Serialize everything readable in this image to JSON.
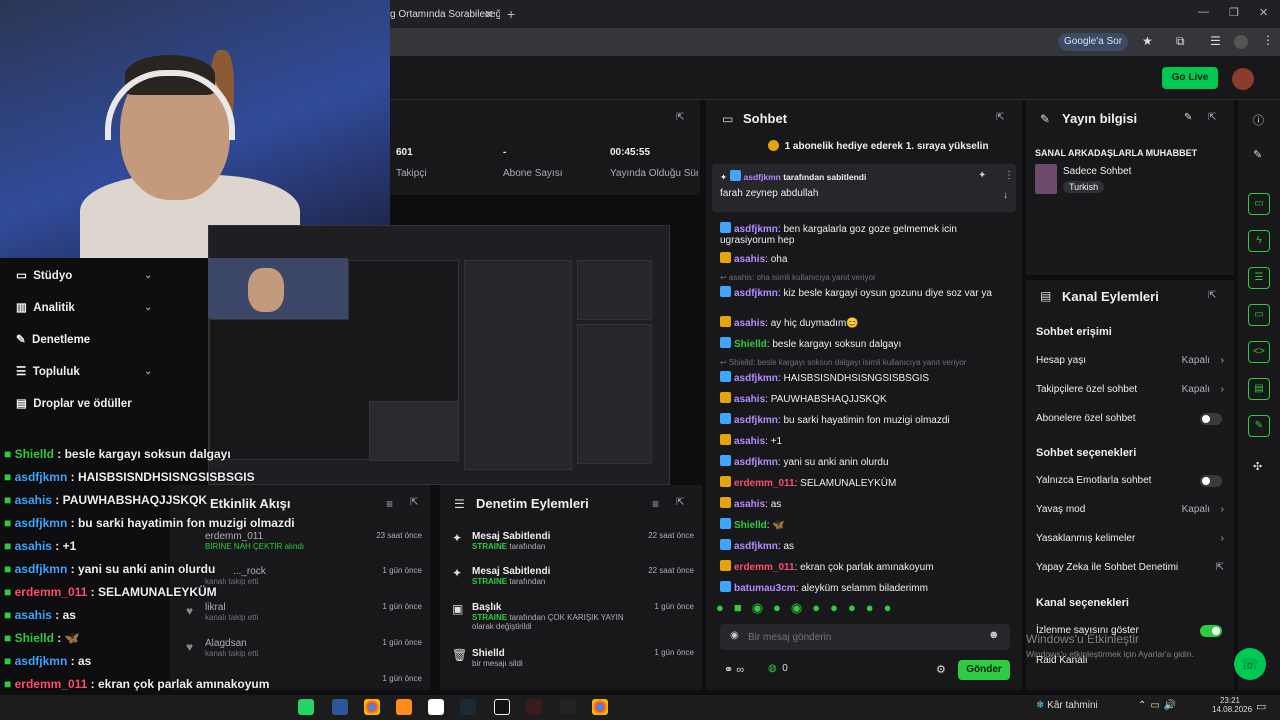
{
  "browser": {
    "tab_title": "g Ortamında Sorabileceğ",
    "google_sor": "Google'a Sor",
    "go_live": "Go Live"
  },
  "nav": {
    "items": [
      {
        "label": "Stüdyo",
        "icon": "studio-icon",
        "chevron": true
      },
      {
        "label": "Analitik",
        "icon": "chart-icon",
        "chevron": true
      },
      {
        "label": "Denetleme",
        "icon": "wrench-icon",
        "chevron": false
      },
      {
        "label": "Topluluk",
        "icon": "people-icon",
        "chevron": true
      },
      {
        "label": "Droplar ve ödüller",
        "icon": "gift-icon",
        "chevron": false
      }
    ]
  },
  "stats": {
    "followers_value": "601",
    "followers_label": "Takipçi",
    "subs_value": "-",
    "subs_label": "Abone Sayısı",
    "uptime_value": "00:45:55",
    "uptime_label": "Yayında Olduğu Süre"
  },
  "overlay_chat": [
    {
      "user": "Shielld",
      "text": " : besle kargayı soksun dalgayı",
      "color": "#2ecc40"
    },
    {
      "user": "asdfjkmn",
      "text": " : HAISBSISNDHSISNGSISBSGIS",
      "color": "#3ea6ff"
    },
    {
      "user": "asahis",
      "text": " : PAUWHABSHAQJJSKQK",
      "color": "#3ea6ff"
    },
    {
      "user": "asdfjkmn",
      "text": " : bu sarki hayatimin fon muzigi olmazdi",
      "color": "#3ea6ff"
    },
    {
      "user": "asahis",
      "text": " : +1",
      "color": "#3ea6ff"
    },
    {
      "user": "asdfjkmn",
      "text": " : yani su anki anin olurdu",
      "color": "#3ea6ff"
    },
    {
      "user": "erdemm_011",
      "text": " : SELAMUNALEYKÜM",
      "color": "#ff4d6d"
    },
    {
      "user": "asahis",
      "text": " : as",
      "color": "#3ea6ff"
    },
    {
      "user": "Shielld",
      "text": " : 🦋",
      "color": "#2ecc40"
    },
    {
      "user": "asdfjkmn",
      "text": " : as",
      "color": "#3ea6ff"
    },
    {
      "user": "erdemm_011",
      "text": " : ekran çok parlak amınakoyum",
      "color": "#ff4d6d"
    },
    {
      "user": "batumau3cm",
      "text": " : aleyküm selamm biladerimm",
      "color": "#a78bfa"
    }
  ],
  "etkinlik": {
    "title": "Etkinlik Akışı",
    "events": [
      {
        "user": "erdemm_011",
        "sub": "BİRİNE NAH ÇEKTİR alındı",
        "time": "23 saat önce"
      },
      {
        "user": "..._rock",
        "sub": "kanalı takip etti",
        "time": "1 gün önce"
      },
      {
        "user": "likral",
        "sub": "kanalı takip etti",
        "time": "1 gün önce"
      },
      {
        "user": "Alagdsan",
        "sub": "kanalı takip etti",
        "time": "1 gün önce"
      },
      {
        "user": "",
        "sub": "",
        "time": "1 gün önce"
      }
    ]
  },
  "denetim": {
    "title": "Denetim Eylemleri",
    "items": [
      {
        "icon": "pin-icon",
        "title": "Mesaj Sabitlendi",
        "user": "STRAINE",
        "sub": " tarafından",
        "time": "22 saat önce"
      },
      {
        "icon": "pin-icon",
        "title": "Mesaj Sabitlendi",
        "user": "STRAINE",
        "sub": " tarafından",
        "time": "22 saat önce"
      },
      {
        "icon": "title-icon",
        "title": "Başlık",
        "user": "STRAINE",
        "sub": " tarafından ÇOK KARIŞIK YAYIN olarak değiştirildi",
        "time": "1 gün önce"
      },
      {
        "icon": "trash-icon",
        "title": "Shielld",
        "user": "",
        "sub": "bir mesajı sildi",
        "time": "1 gün önce"
      }
    ]
  },
  "chat": {
    "title": "Sohbet",
    "sub_banner": "1 abonelik hediye ederek 1. sıraya yükselin",
    "pinned_by": "asdfjkmn",
    "pinned_by_suffix": " tarafından sabitlendi",
    "pinned_text": "farah zeynep abdullah",
    "messages": [
      {
        "user": "asdfjkmn",
        "text": ": ben kargalarla goz goze gelmemek icin ugrasiyorum hep",
        "color": "#b48cff",
        "badge": "k"
      },
      {
        "user": "asahis",
        "text": ": oha",
        "color": "#b48cff",
        "badge": "c"
      },
      {
        "reply": "asahis: oha isimli kullanıcıya yanıt veriyor"
      },
      {
        "user": "asdfjkmn",
        "text": ": kiz besle kargayi oysun gozunu diye soz var ya",
        "color": "#b48cff",
        "badge": "k"
      },
      {
        "user": "asahis",
        "text": ": ay hiç duymadım😊",
        "color": "#b48cff",
        "badge": "c"
      },
      {
        "user": "Shielld",
        "text": ": besle kargayı soksun dalgayı",
        "color": "#2ecc40",
        "badge": "k"
      },
      {
        "reply": "Shielld: besle kargayı soksun dalgayı isimli kullanıcıya yanıt veriyor"
      },
      {
        "user": "asdfjkmn",
        "text": ": HAISBSISNDHSISNGSISBSGIS",
        "color": "#b48cff",
        "badge": "k"
      },
      {
        "user": "asahis",
        "text": ": PAUWHABSHAQJJSKQK",
        "color": "#b48cff",
        "badge": "c"
      },
      {
        "user": "asdfjkmn",
        "text": ": bu sarki hayatimin fon muzigi olmazdi",
        "color": "#b48cff",
        "badge": "k"
      },
      {
        "user": "asahis",
        "text": ": +1",
        "color": "#b48cff",
        "badge": "c"
      },
      {
        "user": "asdfjkmn",
        "text": ": yani su anki anin olurdu",
        "color": "#b48cff",
        "badge": "k"
      },
      {
        "user": "erdemm_011",
        "text": ": SELAMUNALEYKÜM",
        "color": "#ff4d6d",
        "badge": "c"
      },
      {
        "user": "asahis",
        "text": ": as",
        "color": "#b48cff",
        "badge": "c"
      },
      {
        "user": "Shielld",
        "text": ": 🦋",
        "color": "#2ecc40",
        "badge": "k"
      },
      {
        "user": "asdfjkmn",
        "text": ": as",
        "color": "#b48cff",
        "badge": "k"
      },
      {
        "user": "erdemm_011",
        "text": ": ekran çok parlak amınakoyum",
        "color": "#ff4d6d",
        "badge": "c"
      },
      {
        "user": "batumau3cm",
        "text": ": aleyküm selamm biladerimm",
        "color": "#b48cff",
        "badge": "k"
      }
    ],
    "input_placeholder": "Bir mesaj gönderin",
    "points": "0",
    "send": "Gönder"
  },
  "yayin": {
    "title": "Yayın bilgisi",
    "stream_title": "SANAL ARKADAŞLARLA MUHABBET",
    "category": "Sadece Sohbet",
    "language": "Turkish"
  },
  "kanal": {
    "title": "Kanal Eylemleri",
    "sohbet_erisimi": "Sohbet erişimi",
    "hesap_yasi": "Hesap yaşı",
    "takipci_ozel": "Takipçilere özel sohbet",
    "abone_ozel": "Abonelere özel sohbet",
    "kapali": "Kapalı",
    "sohbet_secenekleri": "Sohbet seçenekleri",
    "emote": "Yalnızca Emotlarla sohbet",
    "yavas": "Yavaş mod",
    "yasak": "Yasaklanmış kelimeler",
    "yapay": "Yapay Zeka ile Sohbet Denetimi",
    "kanal_secenekleri": "Kanal seçenekleri",
    "izlenme": "İzlenme sayısını göster",
    "raid": "Raid Kanalı"
  },
  "windows": {
    "line1": "Windows'u Etkinleştir",
    "line2": "Windows'u etkinleştirmek için Ayarlar'a gidin."
  },
  "taskbar": {
    "weather": "Kâr tahmini",
    "time": "23:21",
    "date": "14.08.2026"
  }
}
